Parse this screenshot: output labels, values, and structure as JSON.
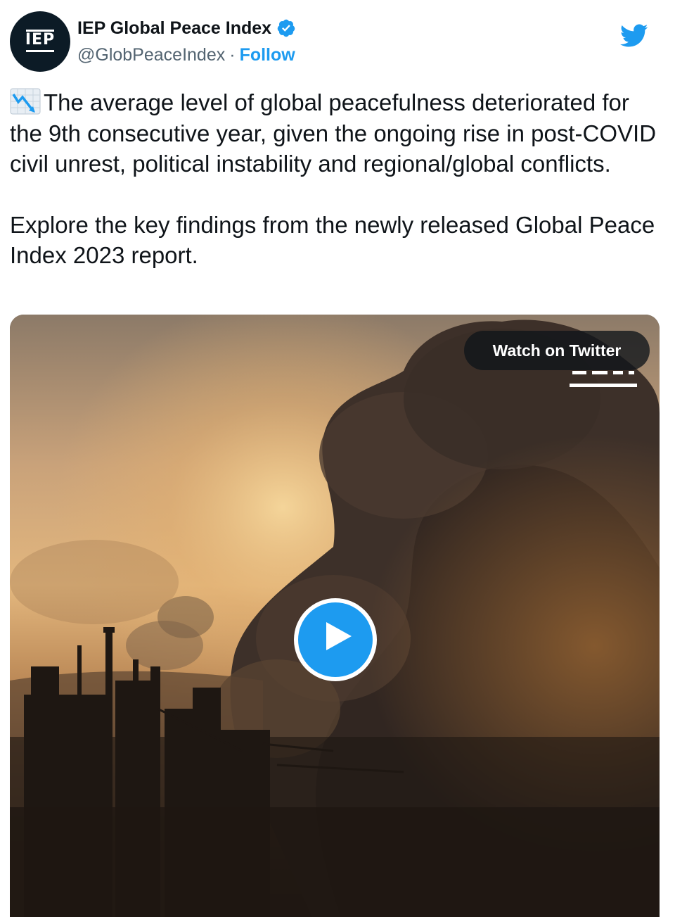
{
  "author": {
    "display_name": "IEP Global Peace Index",
    "handle": "@GlobPeaceIndex",
    "separator": "·",
    "follow_label": "Follow",
    "avatar_text": "IEP",
    "verified_icon": "verified-badge-icon"
  },
  "tweet": {
    "emoji": "chart-decreasing-icon",
    "paragraph1": "The average level of global peacefulness deteriorated for the 9th consecutive year, given the ongoing rise in post-COVID civil unrest, political instability and regional/global conflicts.",
    "paragraph2": "Explore the key findings from the newly released Global Peace Index 2023 report."
  },
  "media": {
    "watch_label": "Watch on Twitter",
    "play_icon": "play-icon",
    "scene": "industrial smoke at sunset"
  },
  "colors": {
    "accent": "#1d9bf0",
    "text": "#0f1419",
    "secondary_text": "#536471",
    "avatar_bg": "#0c1b26"
  }
}
